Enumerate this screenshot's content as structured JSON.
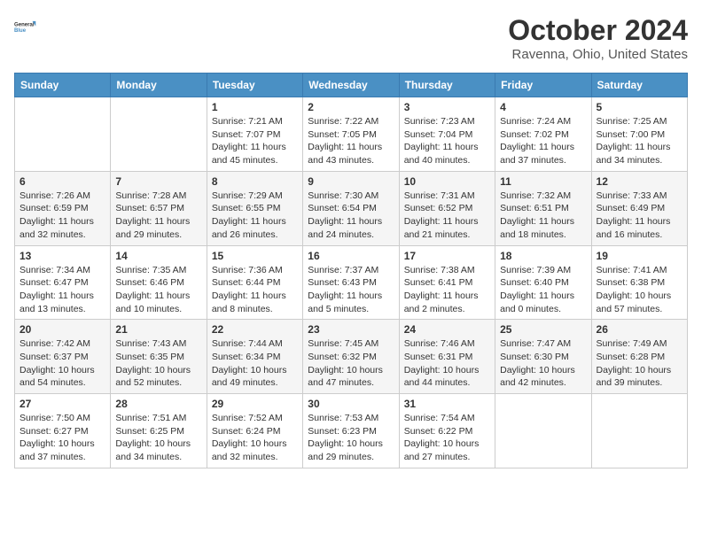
{
  "header": {
    "logo_line1": "General",
    "logo_line2": "Blue",
    "month_title": "October 2024",
    "location": "Ravenna, Ohio, United States"
  },
  "days_of_week": [
    "Sunday",
    "Monday",
    "Tuesday",
    "Wednesday",
    "Thursday",
    "Friday",
    "Saturday"
  ],
  "weeks": [
    [
      {
        "day": "",
        "info": ""
      },
      {
        "day": "",
        "info": ""
      },
      {
        "day": "1",
        "info": "Sunrise: 7:21 AM\nSunset: 7:07 PM\nDaylight: 11 hours and 45 minutes."
      },
      {
        "day": "2",
        "info": "Sunrise: 7:22 AM\nSunset: 7:05 PM\nDaylight: 11 hours and 43 minutes."
      },
      {
        "day": "3",
        "info": "Sunrise: 7:23 AM\nSunset: 7:04 PM\nDaylight: 11 hours and 40 minutes."
      },
      {
        "day": "4",
        "info": "Sunrise: 7:24 AM\nSunset: 7:02 PM\nDaylight: 11 hours and 37 minutes."
      },
      {
        "day": "5",
        "info": "Sunrise: 7:25 AM\nSunset: 7:00 PM\nDaylight: 11 hours and 34 minutes."
      }
    ],
    [
      {
        "day": "6",
        "info": "Sunrise: 7:26 AM\nSunset: 6:59 PM\nDaylight: 11 hours and 32 minutes."
      },
      {
        "day": "7",
        "info": "Sunrise: 7:28 AM\nSunset: 6:57 PM\nDaylight: 11 hours and 29 minutes."
      },
      {
        "day": "8",
        "info": "Sunrise: 7:29 AM\nSunset: 6:55 PM\nDaylight: 11 hours and 26 minutes."
      },
      {
        "day": "9",
        "info": "Sunrise: 7:30 AM\nSunset: 6:54 PM\nDaylight: 11 hours and 24 minutes."
      },
      {
        "day": "10",
        "info": "Sunrise: 7:31 AM\nSunset: 6:52 PM\nDaylight: 11 hours and 21 minutes."
      },
      {
        "day": "11",
        "info": "Sunrise: 7:32 AM\nSunset: 6:51 PM\nDaylight: 11 hours and 18 minutes."
      },
      {
        "day": "12",
        "info": "Sunrise: 7:33 AM\nSunset: 6:49 PM\nDaylight: 11 hours and 16 minutes."
      }
    ],
    [
      {
        "day": "13",
        "info": "Sunrise: 7:34 AM\nSunset: 6:47 PM\nDaylight: 11 hours and 13 minutes."
      },
      {
        "day": "14",
        "info": "Sunrise: 7:35 AM\nSunset: 6:46 PM\nDaylight: 11 hours and 10 minutes."
      },
      {
        "day": "15",
        "info": "Sunrise: 7:36 AM\nSunset: 6:44 PM\nDaylight: 11 hours and 8 minutes."
      },
      {
        "day": "16",
        "info": "Sunrise: 7:37 AM\nSunset: 6:43 PM\nDaylight: 11 hours and 5 minutes."
      },
      {
        "day": "17",
        "info": "Sunrise: 7:38 AM\nSunset: 6:41 PM\nDaylight: 11 hours and 2 minutes."
      },
      {
        "day": "18",
        "info": "Sunrise: 7:39 AM\nSunset: 6:40 PM\nDaylight: 11 hours and 0 minutes."
      },
      {
        "day": "19",
        "info": "Sunrise: 7:41 AM\nSunset: 6:38 PM\nDaylight: 10 hours and 57 minutes."
      }
    ],
    [
      {
        "day": "20",
        "info": "Sunrise: 7:42 AM\nSunset: 6:37 PM\nDaylight: 10 hours and 54 minutes."
      },
      {
        "day": "21",
        "info": "Sunrise: 7:43 AM\nSunset: 6:35 PM\nDaylight: 10 hours and 52 minutes."
      },
      {
        "day": "22",
        "info": "Sunrise: 7:44 AM\nSunset: 6:34 PM\nDaylight: 10 hours and 49 minutes."
      },
      {
        "day": "23",
        "info": "Sunrise: 7:45 AM\nSunset: 6:32 PM\nDaylight: 10 hours and 47 minutes."
      },
      {
        "day": "24",
        "info": "Sunrise: 7:46 AM\nSunset: 6:31 PM\nDaylight: 10 hours and 44 minutes."
      },
      {
        "day": "25",
        "info": "Sunrise: 7:47 AM\nSunset: 6:30 PM\nDaylight: 10 hours and 42 minutes."
      },
      {
        "day": "26",
        "info": "Sunrise: 7:49 AM\nSunset: 6:28 PM\nDaylight: 10 hours and 39 minutes."
      }
    ],
    [
      {
        "day": "27",
        "info": "Sunrise: 7:50 AM\nSunset: 6:27 PM\nDaylight: 10 hours and 37 minutes."
      },
      {
        "day": "28",
        "info": "Sunrise: 7:51 AM\nSunset: 6:25 PM\nDaylight: 10 hours and 34 minutes."
      },
      {
        "day": "29",
        "info": "Sunrise: 7:52 AM\nSunset: 6:24 PM\nDaylight: 10 hours and 32 minutes."
      },
      {
        "day": "30",
        "info": "Sunrise: 7:53 AM\nSunset: 6:23 PM\nDaylight: 10 hours and 29 minutes."
      },
      {
        "day": "31",
        "info": "Sunrise: 7:54 AM\nSunset: 6:22 PM\nDaylight: 10 hours and 27 minutes."
      },
      {
        "day": "",
        "info": ""
      },
      {
        "day": "",
        "info": ""
      }
    ]
  ]
}
